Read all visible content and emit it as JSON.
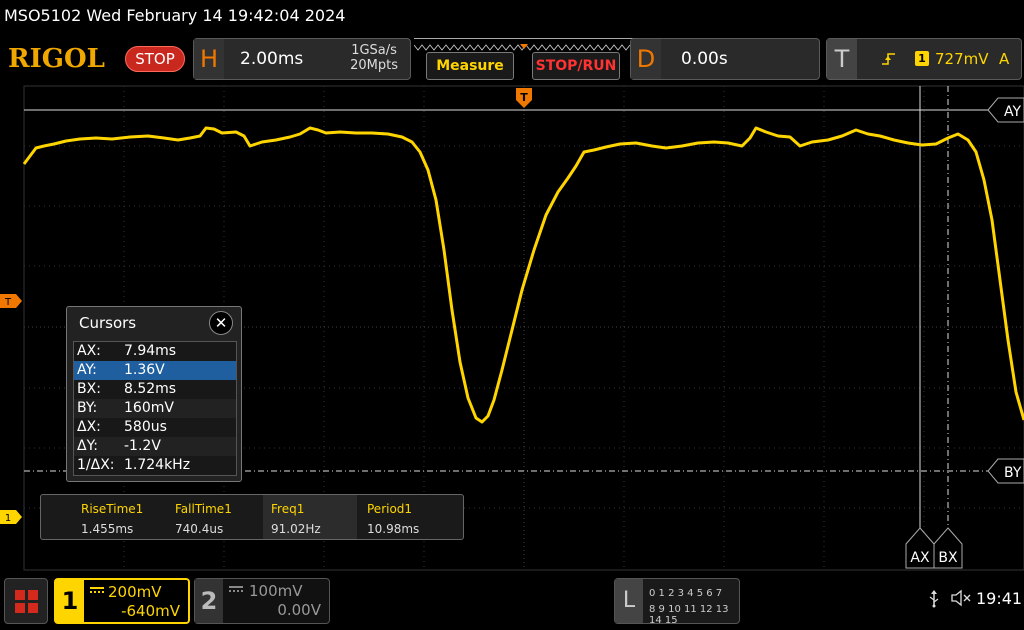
{
  "titlebar": {
    "text": "MSO5102  Wed February 14 19:42:04 2024"
  },
  "header": {
    "logo": "RIGOL",
    "run_status": "STOP",
    "horizontal": {
      "letter": "H",
      "timebase": "2.00ms",
      "sample_rate": "1GSa/s",
      "memory_depth": "20Mpts"
    },
    "measure_label": "Measure",
    "stoprun_label": "STOP/RUN",
    "delay": {
      "letter": "D",
      "value": "0.00s"
    },
    "trigger": {
      "letter": "T",
      "source": "1",
      "level": "727mV",
      "mode": "A"
    }
  },
  "screen": {
    "trigger_pos_marker": "T",
    "trigger_level_marker": "T",
    "ch1_marker": "1",
    "cursor_labels": {
      "ay": "AY",
      "by": "BY",
      "ax": "AX",
      "bx": "BX"
    }
  },
  "cursors": {
    "title": "Cursors",
    "close": "✕",
    "rows": [
      {
        "key": "AX:",
        "value": "7.94ms"
      },
      {
        "key": "AY:",
        "value": "1.36V"
      },
      {
        "key": "BX:",
        "value": "8.52ms"
      },
      {
        "key": "BY:",
        "value": "160mV"
      },
      {
        "key": "ΔX:",
        "value": "580us"
      },
      {
        "key": "ΔY:",
        "value": "-1.2V"
      },
      {
        "key": "1/ΔX:",
        "value": "1.724kHz"
      }
    ]
  },
  "measurements": [
    {
      "name": "RiseTime1",
      "value": "1.455ms"
    },
    {
      "name": "FallTime1",
      "value": "740.4us"
    },
    {
      "name": "Freq1",
      "value": "91.02Hz"
    },
    {
      "name": "Period1",
      "value": "10.98ms"
    }
  ],
  "bottom": {
    "ch1": {
      "num": "1",
      "scale": "200mV",
      "offset": "-640mV"
    },
    "ch2": {
      "num": "2",
      "scale": "100mV",
      "offset": "0.00V"
    },
    "la": {
      "letter": "L",
      "row1": "0 1 2 3  4 5 6 7",
      "row2": "8 9 10 11 12 13 14 15"
    },
    "clock": "19:41"
  },
  "colors": {
    "ch1": "#ffd500",
    "accent": "#f07800",
    "stop": "#c8281e"
  }
}
